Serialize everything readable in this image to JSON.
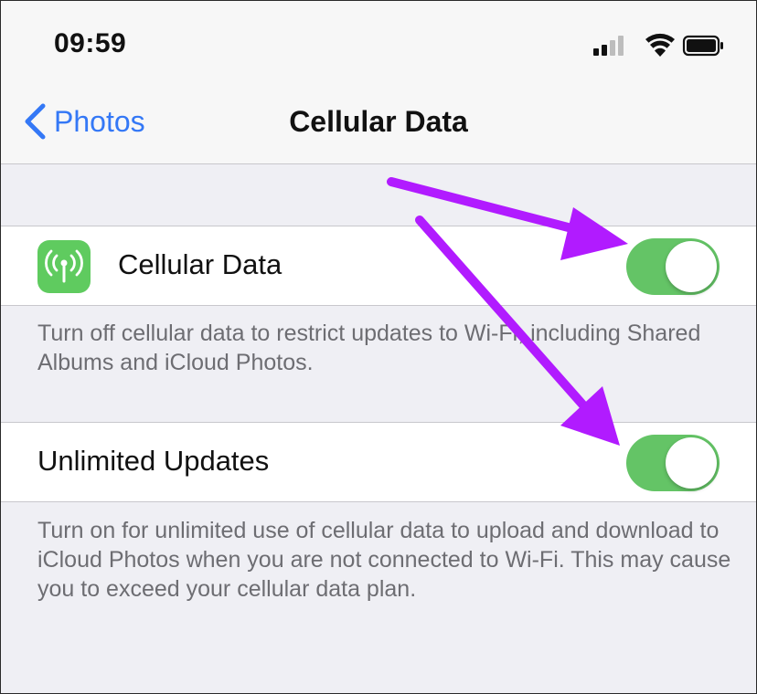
{
  "status_bar": {
    "time": "09:59",
    "icons": [
      "cellular-signal-icon",
      "wifi-icon",
      "battery-icon"
    ]
  },
  "nav": {
    "back_label": "Photos",
    "title": "Cellular Data"
  },
  "settings": [
    {
      "label": "Cellular Data",
      "icon": "antenna-icon",
      "toggle_on": true,
      "footer": "Turn off cellular data to restrict updates to Wi-Fi, including Shared Albums and iCloud Photos."
    },
    {
      "label": "Unlimited Updates",
      "toggle_on": true,
      "footer": "Turn on for unlimited use of cellular data to upload and download to iCloud Photos when you are not connected to Wi-Fi. This may cause you to exceed your cellular data plan."
    }
  ],
  "colors": {
    "accent": "#3478f6",
    "toggle_on": "#64c466",
    "icon_green": "#5fcb5f",
    "annotation_arrow": "#b11bff",
    "background": "#efeff4"
  }
}
